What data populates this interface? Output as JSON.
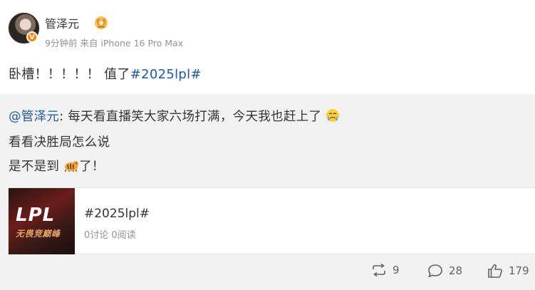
{
  "post": {
    "author": "管泽元",
    "meta": "9分钟前 来自 iPhone 16 Pro Max",
    "verified_badge": "V",
    "content_text": "卧槽！！！！！ 值了",
    "content_tag": "#2025lpl#"
  },
  "repost": {
    "mention": "@管泽元",
    "line1_text": ": 每天看直播笑大家六场打满，今天我也赶上了",
    "line2": "看看决胜局怎么说",
    "line3_a": "是不是到",
    "line3_b": "了！",
    "card": {
      "logo_text": "LPL",
      "slogan": "无畏竞巅峰",
      "title": "#2025lpl#",
      "stats": "0讨论 0阅读"
    },
    "actions": {
      "repost_count": "9",
      "comment_count": "28",
      "like_count": "179"
    }
  },
  "icons": [
    "avatar",
    "verified-icon",
    "crown-badge-icon",
    "crying-emoji-icon",
    "tiger-emoji-icon",
    "repost-icon",
    "comment-icon",
    "like-icon"
  ],
  "colors": {
    "link": "#1f5aa6",
    "meta": "#939393",
    "verified": "#ff8200",
    "repost_bg": "#f2f2f2"
  }
}
